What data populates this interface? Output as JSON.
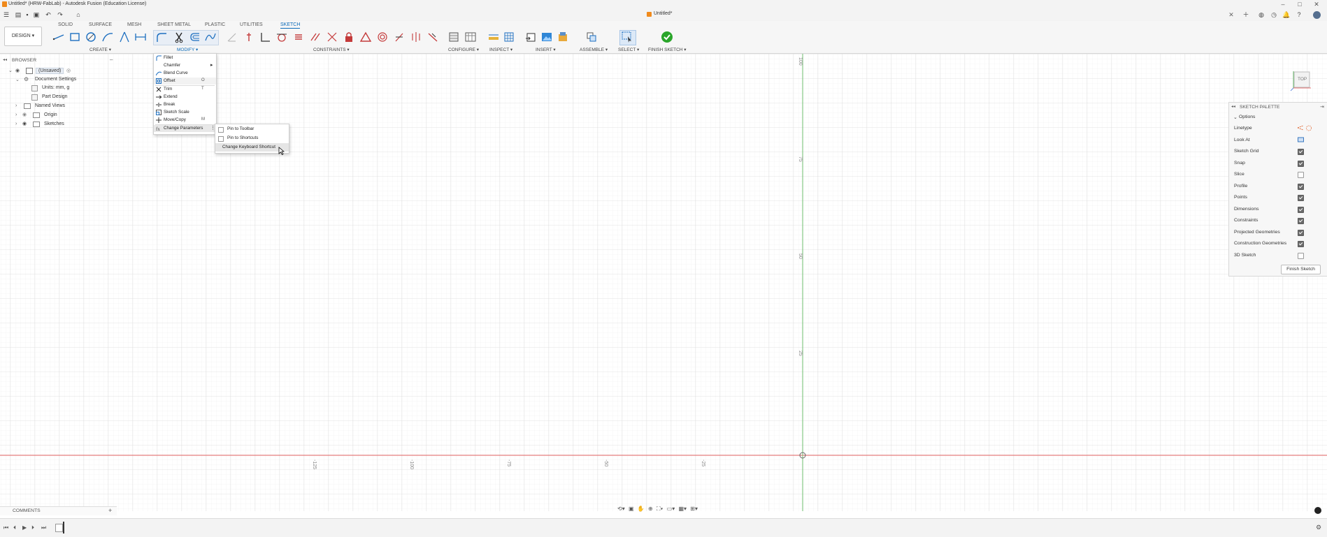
{
  "app": {
    "window_title": "Untitled* (HRW-FabLab) - Autodesk Fusion (Education License)",
    "document_tab": "Untitled*"
  },
  "toolbar": {
    "design_label": "DESIGN",
    "workspace_tabs": [
      "SOLID",
      "SURFACE",
      "MESH",
      "SHEET METAL",
      "PLASTIC",
      "UTILITIES",
      "SKETCH"
    ],
    "active_tab": "SKETCH",
    "groups": {
      "create": "CREATE",
      "modify": "MODIFY",
      "constraints": "CONSTRAINTS",
      "configure": "CONFIGURE",
      "inspect": "INSPECT",
      "insert": "INSERT",
      "assemble": "ASSEMBLE",
      "select": "SELECT",
      "finish_sketch": "FINISH SKETCH"
    },
    "accent_color": "#0b6ab8",
    "finish_color": "#2aa52a"
  },
  "browser": {
    "title": "BROWSER",
    "root": "(Unsaved)",
    "items": {
      "document_settings": "Document Settings",
      "units": "Units: mm, g",
      "part_design": "Part Design",
      "named_views": "Named Views",
      "origin": "Origin",
      "sketches": "Sketches"
    }
  },
  "modify_menu": {
    "items": [
      {
        "label": "Fillet",
        "shortcut": "",
        "icon": "fillet-icon"
      },
      {
        "label": "Chamfer",
        "shortcut": "",
        "icon": "",
        "submenu": true
      },
      {
        "label": "Blend Curve",
        "shortcut": "",
        "icon": "blend-curve-icon"
      },
      {
        "label": "Offset",
        "shortcut": "O",
        "icon": "offset-icon"
      },
      {
        "label": "Trim",
        "shortcut": "T",
        "icon": "trim-icon"
      },
      {
        "label": "Extend",
        "shortcut": "",
        "icon": "extend-icon"
      },
      {
        "label": "Break",
        "shortcut": "",
        "icon": "break-icon"
      },
      {
        "label": "Sketch Scale",
        "shortcut": "",
        "icon": "sketch-scale-icon"
      },
      {
        "label": "Move/Copy",
        "shortcut": "M",
        "icon": "move-copy-icon"
      },
      {
        "label": "Change Parameters",
        "shortcut": "",
        "icon": "change-parameters-icon"
      }
    ]
  },
  "context_submenu": {
    "items": [
      "Pin to Toolbar",
      "Pin to Shortcuts",
      "Change Keyboard Shortcut"
    ],
    "highlighted": "Change Keyboard Shortcut"
  },
  "viewcube": {
    "face": "TOP"
  },
  "sketch_palette": {
    "title": "SKETCH PALETTE",
    "options_label": "Options",
    "rows": [
      {
        "label": "Linetype",
        "type": "icons"
      },
      {
        "label": "Look At",
        "type": "icon"
      },
      {
        "label": "Sketch Grid",
        "checked": true
      },
      {
        "label": "Snap",
        "checked": true
      },
      {
        "label": "Slice",
        "checked": false
      },
      {
        "label": "Profile",
        "checked": true
      },
      {
        "label": "Points",
        "checked": true
      },
      {
        "label": "Dimensions",
        "checked": true
      },
      {
        "label": "Constraints",
        "checked": true
      },
      {
        "label": "Projected Geometries",
        "checked": true
      },
      {
        "label": "Construction Geometries",
        "checked": true
      },
      {
        "label": "3D Sketch",
        "checked": false
      }
    ],
    "finish_button": "Finish Sketch"
  },
  "axes": {
    "vertical_labels": [
      "100",
      "75",
      "50",
      "25"
    ],
    "horizontal_labels": [
      "-125",
      "-100",
      "-75",
      "-50",
      "-25"
    ]
  },
  "comments": {
    "title": "COMMENTS"
  }
}
